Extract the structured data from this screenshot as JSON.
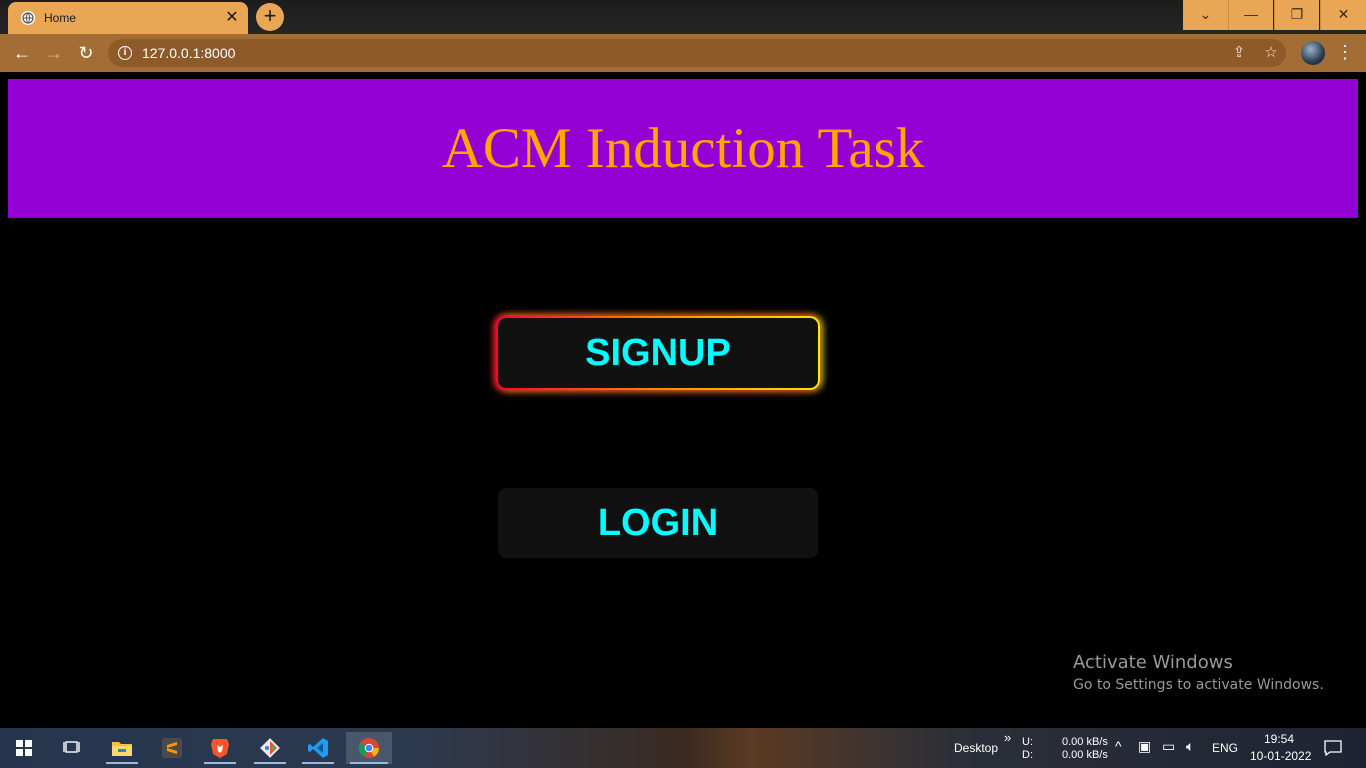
{
  "browser": {
    "tab_title": "Home",
    "tab_close": "✕",
    "new_tab": "+",
    "url": "127.0.0.1:8000",
    "window_controls": {
      "dropdown": "⌄",
      "minimize": "—",
      "restore": "❐",
      "close": "✕"
    }
  },
  "page": {
    "title": "ACM Induction Task",
    "signup_label": "SIGNUP",
    "login_label": "LOGIN"
  },
  "watermark": {
    "title": "Activate Windows",
    "subtitle": "Go to Settings to activate Windows."
  },
  "taskbar": {
    "desktop_label": "Desktop",
    "chevrons": "»",
    "upload_label": "U:",
    "download_label": "D:",
    "upload_speed": "0.00 kB/s",
    "download_speed": "0.00 kB/s",
    "language": "ENG",
    "time": "19:54",
    "date": "10-01-2022"
  },
  "colors": {
    "banner_bg": "#9400d3",
    "title_color": "#ffa500",
    "button_text": "#00ffff",
    "chrome_accent": "#e9a756",
    "toolbar_bg": "#a56d36"
  }
}
